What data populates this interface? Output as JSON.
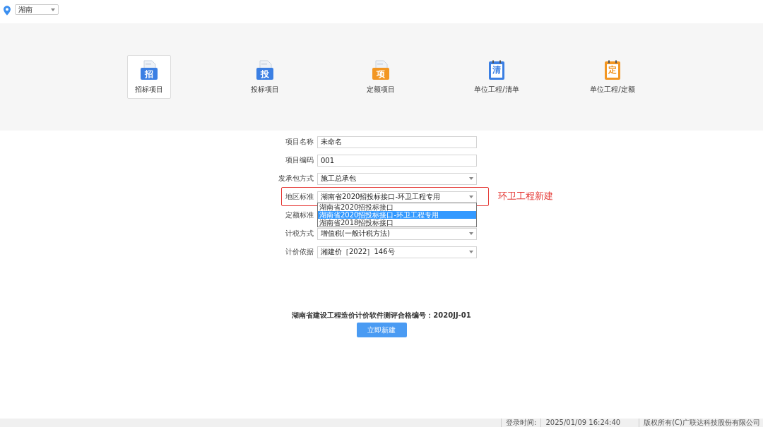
{
  "region_select": {
    "value": "湖南"
  },
  "tiles": [
    {
      "label": "招标项目",
      "glyph": "招",
      "kind": "folder",
      "color": "#3b7fe3",
      "selected": true
    },
    {
      "label": "投标项目",
      "glyph": "投",
      "kind": "folder",
      "color": "#3b7fe3",
      "selected": false
    },
    {
      "label": "定额项目",
      "glyph": "项",
      "kind": "folder",
      "color": "#f29622",
      "selected": false
    },
    {
      "label": "单位工程/清单",
      "glyph": "清",
      "kind": "notepad",
      "color": "#3b7fe3",
      "selected": false
    },
    {
      "label": "单位工程/定额",
      "glyph": "定",
      "kind": "notepad",
      "color": "#f29622",
      "selected": false
    }
  ],
  "form": [
    {
      "label": "项目名称",
      "kind": "text",
      "value": "未命名"
    },
    {
      "label": "项目编码",
      "kind": "text",
      "value": "001"
    },
    {
      "label": "发承包方式",
      "kind": "select",
      "value": "施工总承包"
    },
    {
      "label": "地区标准",
      "kind": "select",
      "value": "湖南省2020招投标接口-环卫工程专用",
      "open": true
    },
    {
      "label": "定额标准",
      "kind": "covered"
    },
    {
      "label": "计税方式",
      "kind": "select",
      "value": "增值税(一般计税方法)"
    },
    {
      "label": "计价依据",
      "kind": "select",
      "value": "湘建价［2022］146号"
    }
  ],
  "dropdown_options": [
    {
      "label": "湖南省2020招投标接口",
      "selected": false
    },
    {
      "label": "湖南省2020招投标接口-环卫工程专用",
      "selected": true
    },
    {
      "label": "湖南省2018招投标接口",
      "selected": false
    }
  ],
  "annotation": {
    "text": "环卫工程新建"
  },
  "certification": "湖南省建设工程造价计价软件测评合格编号：2020JJ-01",
  "create_button": "立即新建",
  "status_bar": [
    {
      "label": "登录时间:",
      "value": "2025/01/09 16:24:40"
    },
    {
      "text": "版权所有(C)广联达科技股份有限公司"
    }
  ]
}
